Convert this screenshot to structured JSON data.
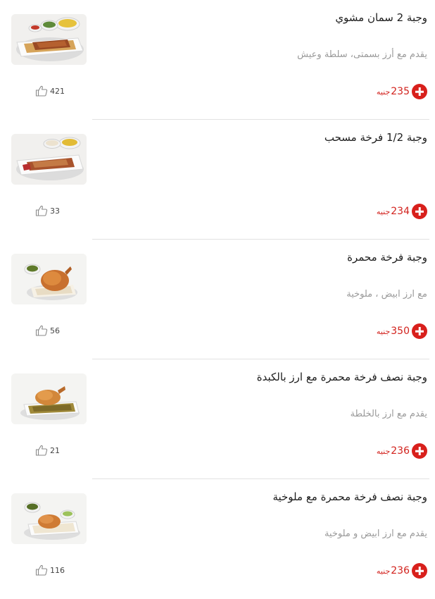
{
  "colors": {
    "accent": "#d8201c",
    "price": "#d2221d",
    "description": "#9a9a9a",
    "divider": "#e2e2e2"
  },
  "currency": "جنيه",
  "items": [
    {
      "title": "وجبة 2 سمان مشوي",
      "description": "يقدم مع أرز بسمتى، سلطة وعيش",
      "price": "235",
      "likes": "421",
      "image_icon": "meal-quail-platter"
    },
    {
      "title": "وجبة 1/2 فرخة مسحب",
      "description": "",
      "price": "234",
      "likes": "33",
      "image_icon": "meal-chicken-strips-platter"
    },
    {
      "title": "وجبة فرخة محمرة",
      "description": "مع ارز ابيض ، ملوخية",
      "price": "350",
      "likes": "56",
      "image_icon": "meal-roasted-chicken"
    },
    {
      "title": "وجبة نصف فرخة محمرة مع ارز بالكبدة",
      "description": "يقدم مع ارز بالخلطة",
      "price": "236",
      "likes": "21",
      "image_icon": "meal-half-chicken-rice"
    },
    {
      "title": "وجبة نصف فرخة محمرة مع ملوخية",
      "description": "يقدم مع ارز ابيض و ملوخية",
      "price": "236",
      "likes": "116",
      "image_icon": "meal-half-chicken-molokhia"
    }
  ]
}
